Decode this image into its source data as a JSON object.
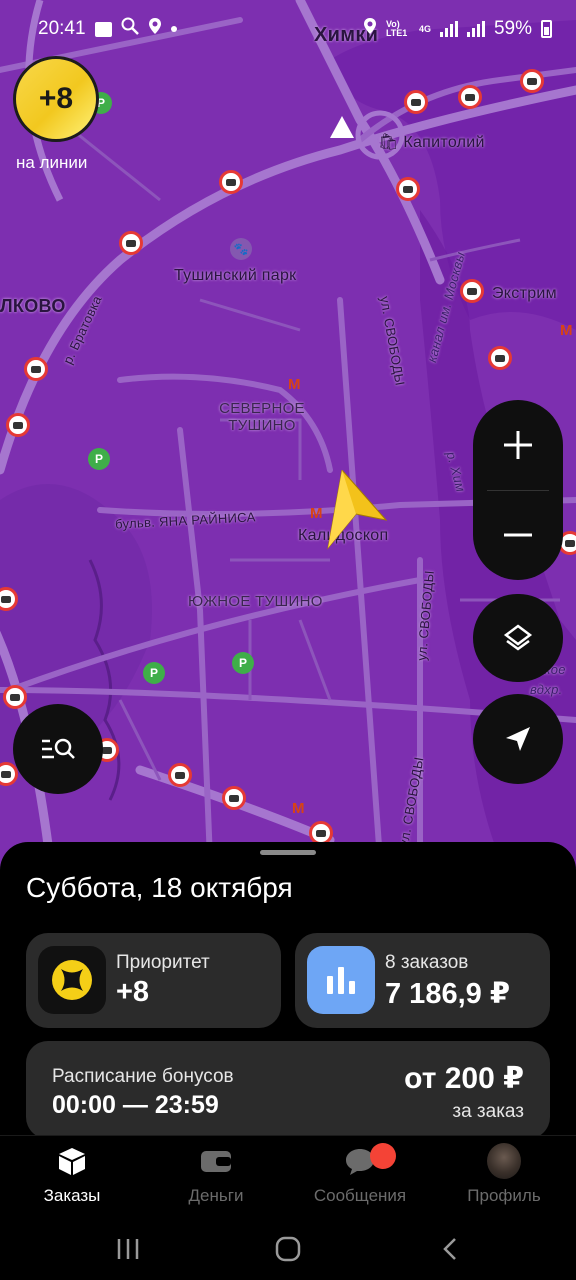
{
  "status_bar": {
    "time": "20:41",
    "network_label": "Vo) LTE1",
    "net_type": "4G",
    "battery": "59%"
  },
  "map": {
    "labels": {
      "khimki": "Химки",
      "capitol": "Капитолий",
      "tushinsky_park": "Тушинский парк",
      "extrim": "Экстрим",
      "krylatskoe_fragment": "ЛКОВО",
      "bratovka": "р. Братовка",
      "severnoe_tushino": "СЕВЕРНОЕ ТУШИНО",
      "yana_rainisa": "бульв. ЯНА РАЙНИСА",
      "skhodnenskaya": "Калидоскоп",
      "yuzhnoe_tushino": "ЮЖНОЕ ТУШИНО",
      "svobody_north": "ул. СВОБОДЫ",
      "svobody_mid": "ул. СВОБОДЫ",
      "svobody_south": "ул. СВОБОДЫ",
      "kanal_moskvy": "канал им. Москвы",
      "reka_khimka": "р. Хим",
      "vodokhranilishche": "нское вдхр."
    }
  },
  "priority_badge": {
    "value": "+8",
    "caption": "на линии"
  },
  "sheet": {
    "date_title": "Суббота, 18 октября",
    "priority_card": {
      "label": "Приоритет",
      "value": "+8"
    },
    "orders_card": {
      "label": "8 заказов",
      "value": "7 186,9 ₽"
    },
    "bonus_card": {
      "title": "Расписание бонусов",
      "time": "00:00 — 23:59",
      "amount": "от 200 ₽",
      "per": "за заказ"
    }
  },
  "tabs": [
    {
      "label": "Заказы",
      "icon": "box-icon",
      "active": true
    },
    {
      "label": "Деньги",
      "icon": "wallet-icon",
      "active": false
    },
    {
      "label": "Сообщения",
      "icon": "chat-icon",
      "active": false
    },
    {
      "label": "Профиль",
      "icon": "avatar",
      "active": false
    }
  ],
  "colors": {
    "map_bg": "#7d2fb0",
    "accent_yellow": "#f2c81f",
    "card_bg": "#2b2b2b",
    "orders_icon_bg": "#6ea6f5",
    "notification_red": "#f44336"
  }
}
